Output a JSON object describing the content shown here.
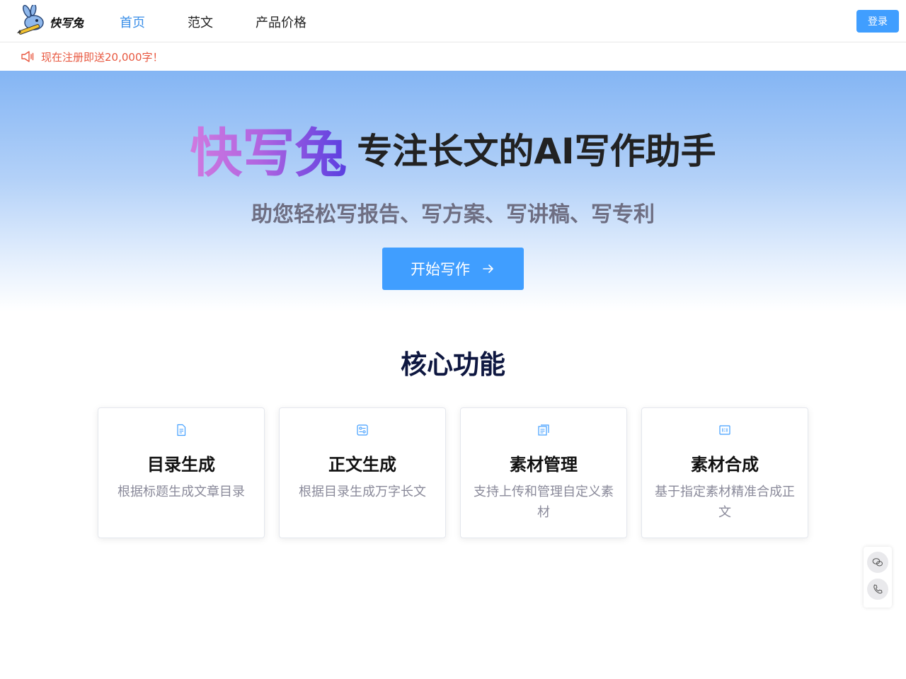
{
  "header": {
    "logo_text": "快写兔",
    "nav": [
      "首页",
      "范文",
      "产品价格"
    ],
    "login_label": "登录"
  },
  "notice": {
    "text": "现在注册即送20,000字！"
  },
  "hero": {
    "brand": "快写兔",
    "slogan": "专注长文的AI写作助手",
    "subtitle": "助您轻松写报告、写方案、写讲稿、写专利",
    "cta_label": "开始写作"
  },
  "features": {
    "title": "核心功能",
    "cards": [
      {
        "title": "目录生成",
        "desc": "根据标题生成文章目录",
        "icon": "document-icon"
      },
      {
        "title": "正文生成",
        "desc": "根据目录生成万字长文",
        "icon": "settings-doc-icon"
      },
      {
        "title": "素材管理",
        "desc": "支持上传和管理自定义素材",
        "icon": "copy-doc-icon"
      },
      {
        "title": "素材合成",
        "desc": "基于指定素材精准合成正文",
        "icon": "ratio-icon"
      }
    ]
  },
  "floating": {
    "buttons": [
      "wechat-icon",
      "phone-icon"
    ]
  },
  "colors": {
    "accent": "#409eff",
    "nav_active": "#3b8fe8",
    "notice": "#e8573f",
    "heading": "#0e1740"
  }
}
